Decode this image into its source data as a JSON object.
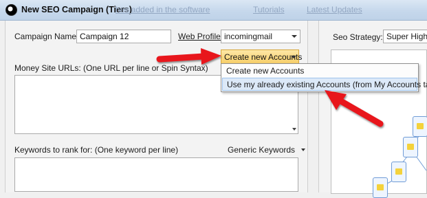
{
  "window": {
    "title": "New SEO Campaign (Tiers)",
    "background_links": [
      "hes added in the software",
      "Tutorials",
      "Latest Updates"
    ]
  },
  "form": {
    "campaign_name_label": "Campaign Name:",
    "campaign_name_value": "Campaign 12",
    "web_profiles_label": "Web Profiles",
    "web_profiles_value": "incomingmail",
    "create_button_label": "Create new Accounts",
    "money_site_label": "Money Site URLs: (One URL per line or Spin Syntax)",
    "keywords_label": "Keywords to rank for: (One keyword per line)",
    "keywords_type_label": "Generic Keywords"
  },
  "dropdown": {
    "items": [
      {
        "label": "Create new Accounts",
        "highlighted": false
      },
      {
        "label": "Use my already existing Accounts (from My Accounts tab)",
        "highlighted": true
      }
    ]
  },
  "strategy": {
    "label": "Seo Strategy:",
    "value": "Super High C"
  },
  "colors": {
    "annotation_arrow": "#e8161c",
    "button_highlight": "#f7cf6a",
    "menu_highlight": "#dce9f8"
  }
}
